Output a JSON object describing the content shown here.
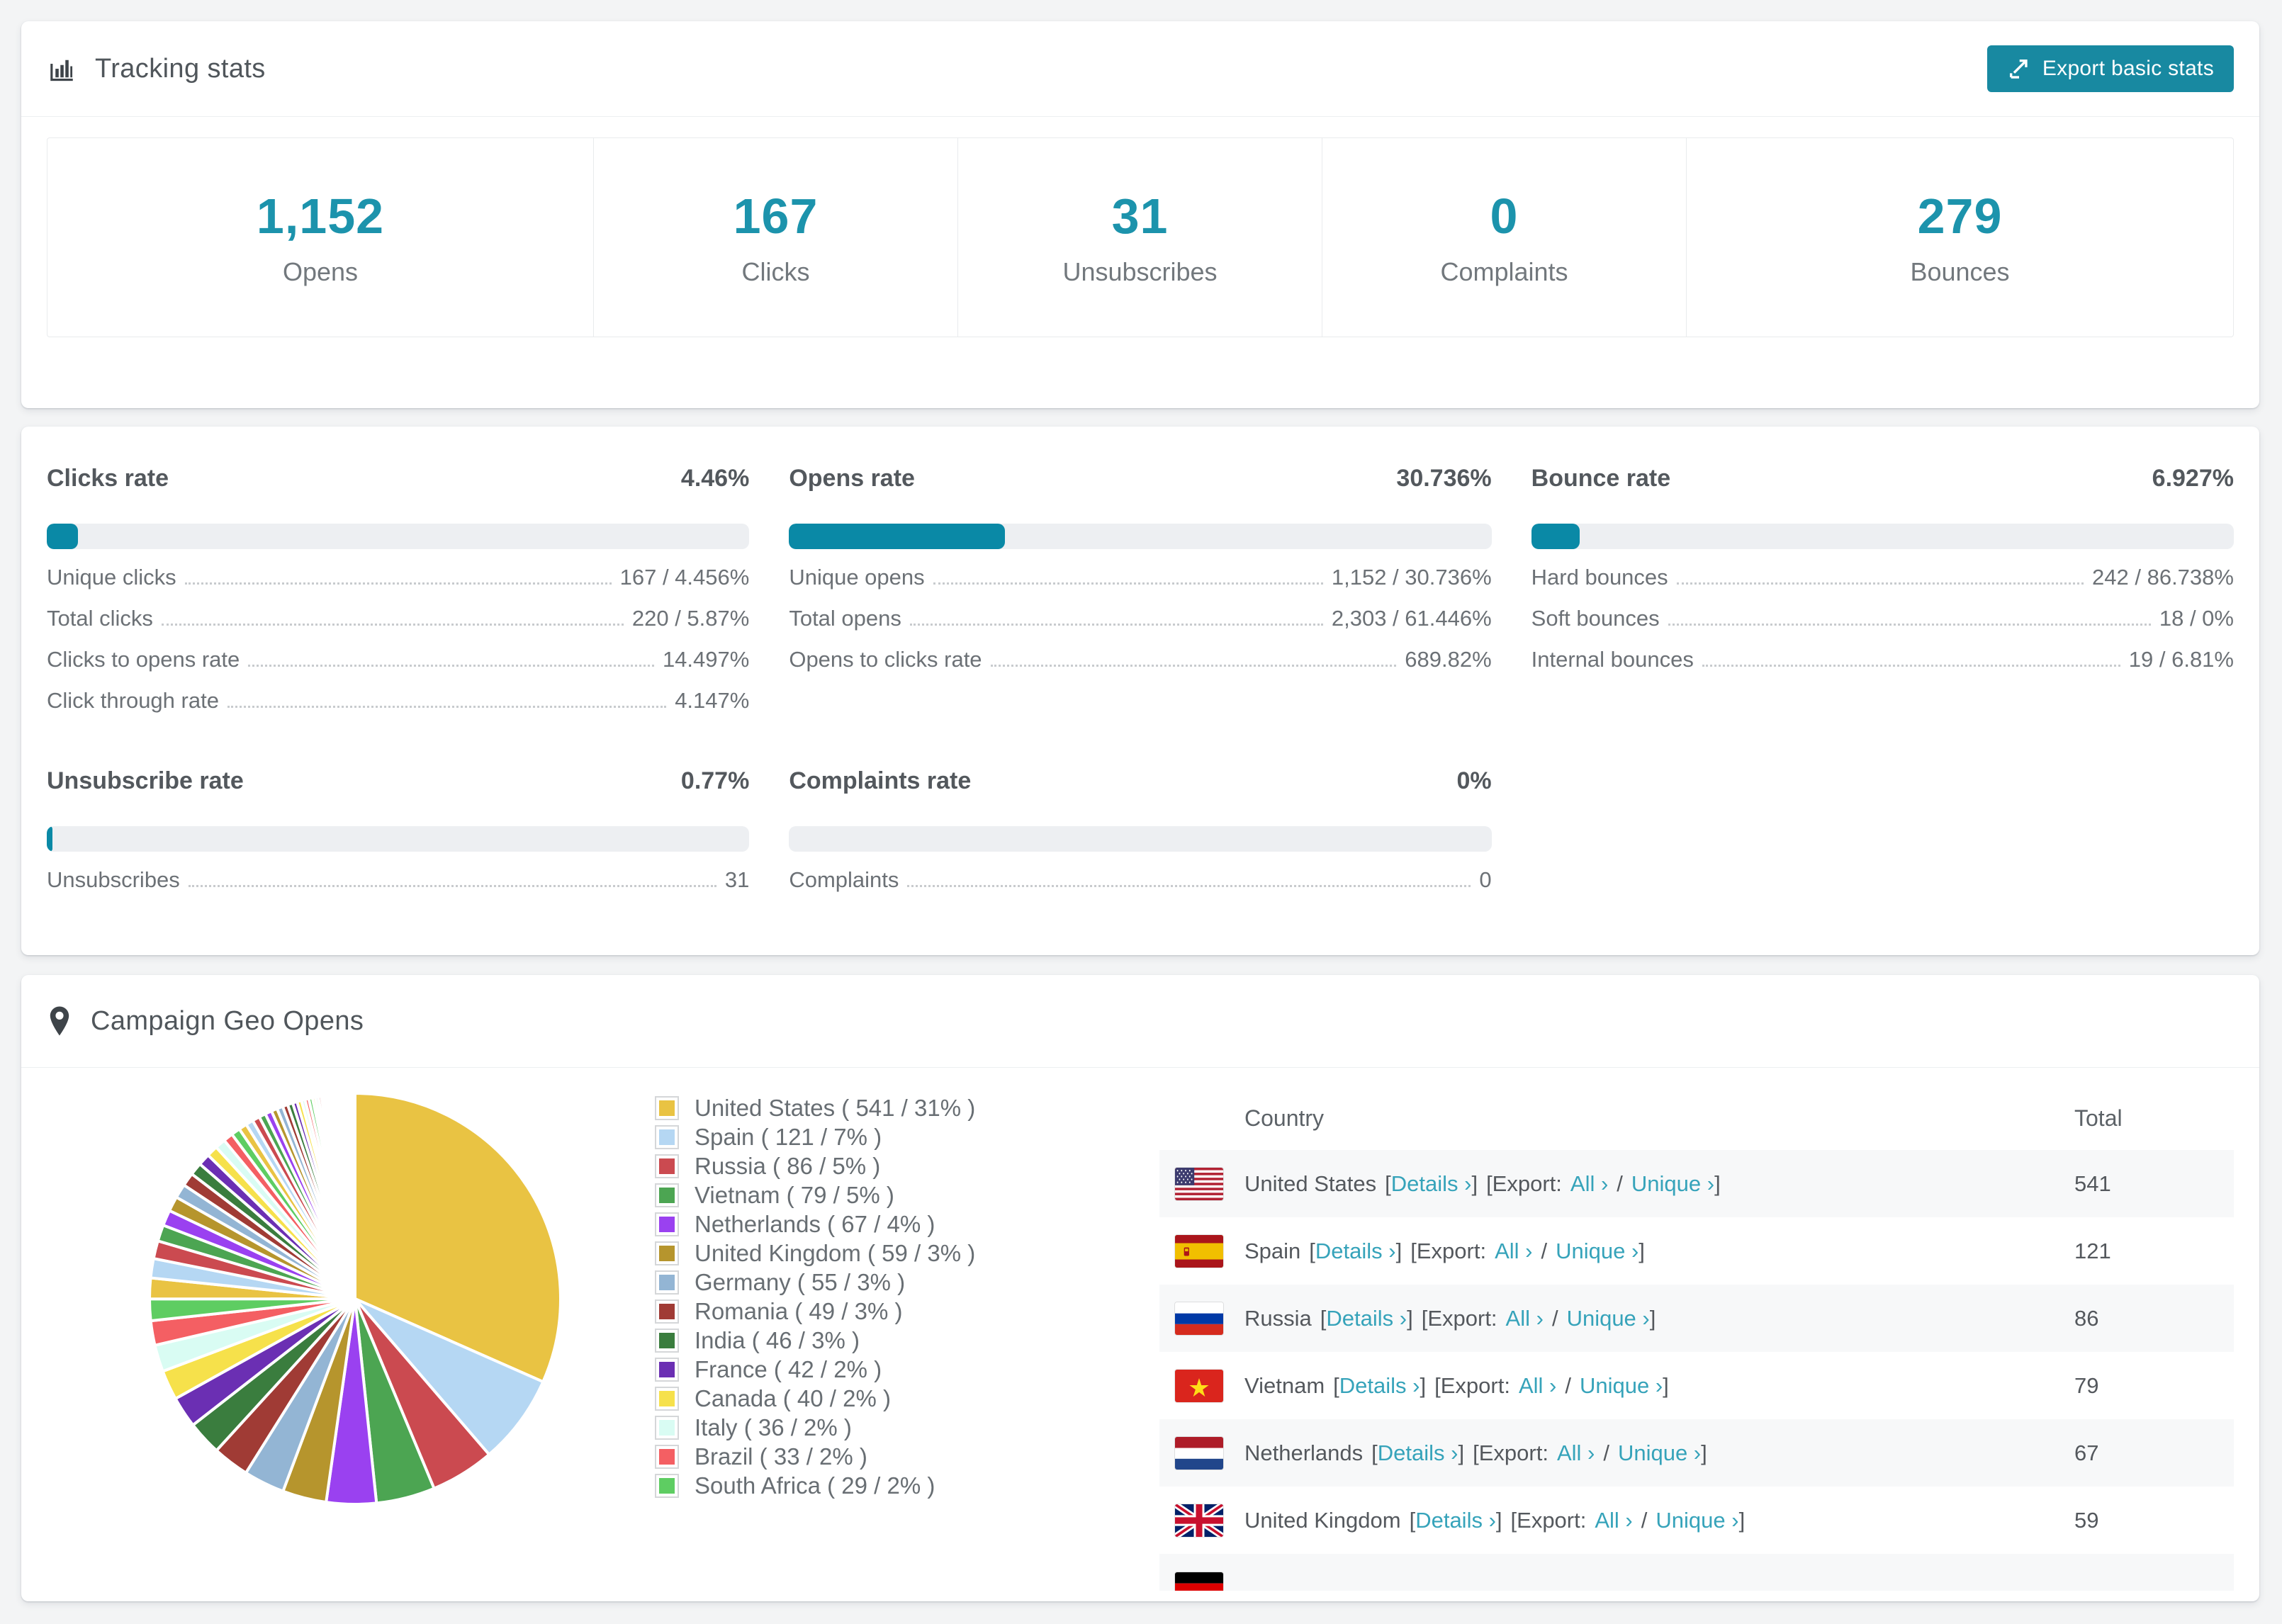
{
  "tracking": {
    "title": "Tracking stats",
    "export_button": "Export basic stats",
    "stats": [
      {
        "value": "1,152",
        "label": "Opens"
      },
      {
        "value": "167",
        "label": "Clicks"
      },
      {
        "value": "31",
        "label": "Unsubscribes"
      },
      {
        "value": "0",
        "label": "Complaints"
      },
      {
        "value": "279",
        "label": "Bounces"
      }
    ]
  },
  "rates": {
    "panels": [
      {
        "title": "Clicks rate",
        "value": "4.46%",
        "percent": 4.46,
        "rows": [
          {
            "label": "Unique clicks",
            "value": "167 / 4.456%"
          },
          {
            "label": "Total clicks",
            "value": "220 / 5.87%"
          },
          {
            "label": "Clicks to opens rate",
            "value": "14.497%"
          },
          {
            "label": "Click through rate",
            "value": "4.147%"
          }
        ]
      },
      {
        "title": "Opens rate",
        "value": "30.736%",
        "percent": 30.736,
        "rows": [
          {
            "label": "Unique opens",
            "value": "1,152 / 30.736%"
          },
          {
            "label": "Total opens",
            "value": "2,303 / 61.446%"
          },
          {
            "label": "Opens to clicks rate",
            "value": "689.82%"
          }
        ]
      },
      {
        "title": "Bounce rate",
        "value": "6.927%",
        "percent": 6.927,
        "rows": [
          {
            "label": "Hard bounces",
            "value": "242 / 86.738%"
          },
          {
            "label": "Soft bounces",
            "value": "18 / 0%"
          },
          {
            "label": "Internal bounces",
            "value": "19 / 6.81%"
          }
        ]
      },
      {
        "title": "Unsubscribe rate",
        "value": "0.77%",
        "percent": 0.77,
        "rows": [
          {
            "label": "Unsubscribes",
            "value": "31"
          }
        ]
      },
      {
        "title": "Complaints rate",
        "value": "0%",
        "percent": 0,
        "rows": [
          {
            "label": "Complaints",
            "value": "0"
          }
        ]
      }
    ]
  },
  "geo": {
    "title": "Campaign Geo Opens",
    "table": {
      "headers": {
        "country": "Country",
        "total": "Total"
      },
      "fmt": {
        "lb": "[",
        "rb": "]",
        "export": "[Export:",
        "slash": "/",
        "details": "Details ›",
        "all": "All ›",
        "unique": "Unique ›"
      },
      "rows": [
        {
          "country": "United States",
          "flag": "us",
          "total": "541"
        },
        {
          "country": "Spain",
          "flag": "es",
          "total": "121"
        },
        {
          "country": "Russia",
          "flag": "ru",
          "total": "86"
        },
        {
          "country": "Vietnam",
          "flag": "vn",
          "total": "79"
        },
        {
          "country": "Netherlands",
          "flag": "nl",
          "total": "67"
        },
        {
          "country": "United Kingdom",
          "flag": "gb",
          "total": "59"
        }
      ],
      "partial_row": {
        "flag": "de"
      }
    }
  },
  "chart_data": {
    "type": "pie",
    "title": "Campaign Geo Opens",
    "legend_position": "right",
    "categories": [
      "United States",
      "Spain",
      "Russia",
      "Vietnam",
      "Netherlands",
      "United Kingdom",
      "Germany",
      "Romania",
      "India",
      "France",
      "Canada",
      "Italy",
      "Brazil",
      "South Africa"
    ],
    "values": [
      541,
      121,
      86,
      79,
      67,
      59,
      55,
      49,
      46,
      42,
      40,
      36,
      33,
      29
    ],
    "percent_labels": [
      "31",
      "7",
      "5",
      "5",
      "4",
      "3",
      "3",
      "3",
      "3",
      "2",
      "2",
      "2",
      "2",
      "2"
    ],
    "colors": [
      "#e9c343",
      "#b5d7f3",
      "#cb4a50",
      "#4ca552",
      "#9a41f0",
      "#b6952d",
      "#93b5d4",
      "#a03b35",
      "#3a7d3e",
      "#6b2fb3",
      "#f6e14b",
      "#d9fcf3",
      "#f45f63",
      "#5ecd62"
    ],
    "others": [
      28,
      26,
      24,
      22,
      21,
      20,
      19,
      18,
      17,
      16,
      15,
      14,
      13,
      12,
      11,
      10,
      10,
      9,
      9,
      8,
      8,
      7,
      7,
      6,
      6,
      5,
      5,
      5,
      4,
      4,
      4,
      3,
      3,
      3,
      3,
      3,
      2,
      2,
      2,
      2,
      2,
      2,
      2,
      2,
      1,
      1,
      1,
      1,
      1,
      1,
      1,
      1,
      1,
      1,
      1,
      1,
      1,
      1
    ]
  },
  "colors": {
    "accent_fill": "#0a89a6",
    "stat_number": "#1c93ac",
    "link": "#36a3ba",
    "button_bg": "#1889a1"
  }
}
